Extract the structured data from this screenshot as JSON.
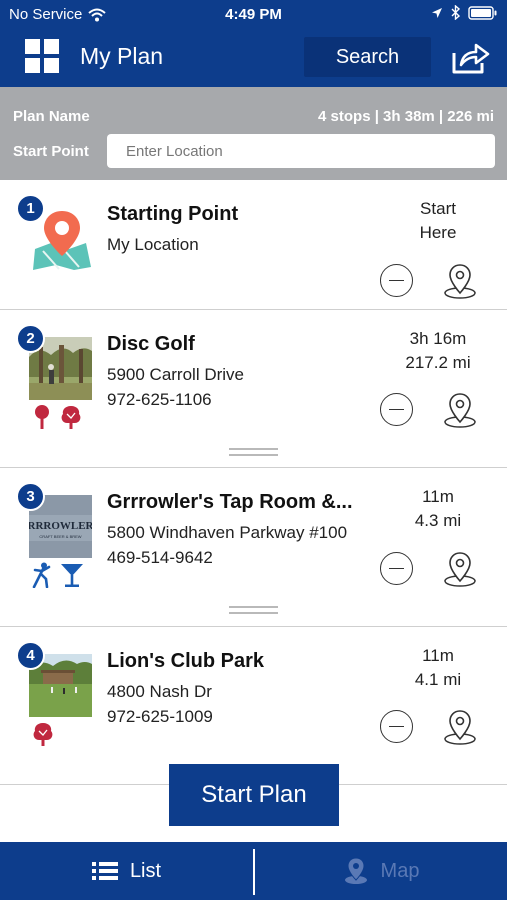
{
  "status_bar": {
    "carrier": "No Service",
    "time": "4:49 PM"
  },
  "header": {
    "title": "My Plan",
    "search_label": "Search",
    "menu_icon": "grid-icon",
    "share_icon": "share-icon"
  },
  "plan": {
    "name_label": "Plan Name",
    "summary": "4 stops | 3h 38m | 226 mi",
    "start_label": "Start Point",
    "start_placeholder": "Enter Location"
  },
  "stops": [
    {
      "number": "1",
      "name": "Starting Point",
      "line1": "My Location",
      "line2": "",
      "time": "Start",
      "distance": "Here"
    },
    {
      "number": "2",
      "name": "Disc Golf",
      "line1": "5900 Carroll Drive",
      "line2": "972-625-1106",
      "time": "3h 16m",
      "distance": "217.2 mi",
      "categories": [
        "golf-icon",
        "park-tree-icon"
      ]
    },
    {
      "number": "3",
      "name": "Grrrowler's Tap Room &...",
      "line1": "5800 Windhaven Parkway #100",
      "line2": "469-514-9642",
      "time": "11m",
      "distance": "4.3 mi",
      "categories": [
        "dance-icon",
        "cocktail-icon"
      ],
      "thumb_text": "RRROWLER",
      "thumb_subtext": "CRAFT BEER & BREW"
    },
    {
      "number": "4",
      "name": "Lion's Club Park",
      "line1": "4800 Nash Dr",
      "line2": "972-625-1009",
      "time": "11m",
      "distance": "4.1 mi",
      "categories": [
        "park-tree-icon"
      ]
    }
  ],
  "actions": {
    "start_plan": "Start Plan"
  },
  "tabs": {
    "list": "List",
    "map": "Map"
  },
  "colors": {
    "primary": "#0d3d8c",
    "plan_bar": "#a7a9ac",
    "category_red": "#c0283f",
    "category_blue": "#1a5cb3",
    "pin_orange": "#f26b4f",
    "map_teal": "#5cc3b8"
  }
}
